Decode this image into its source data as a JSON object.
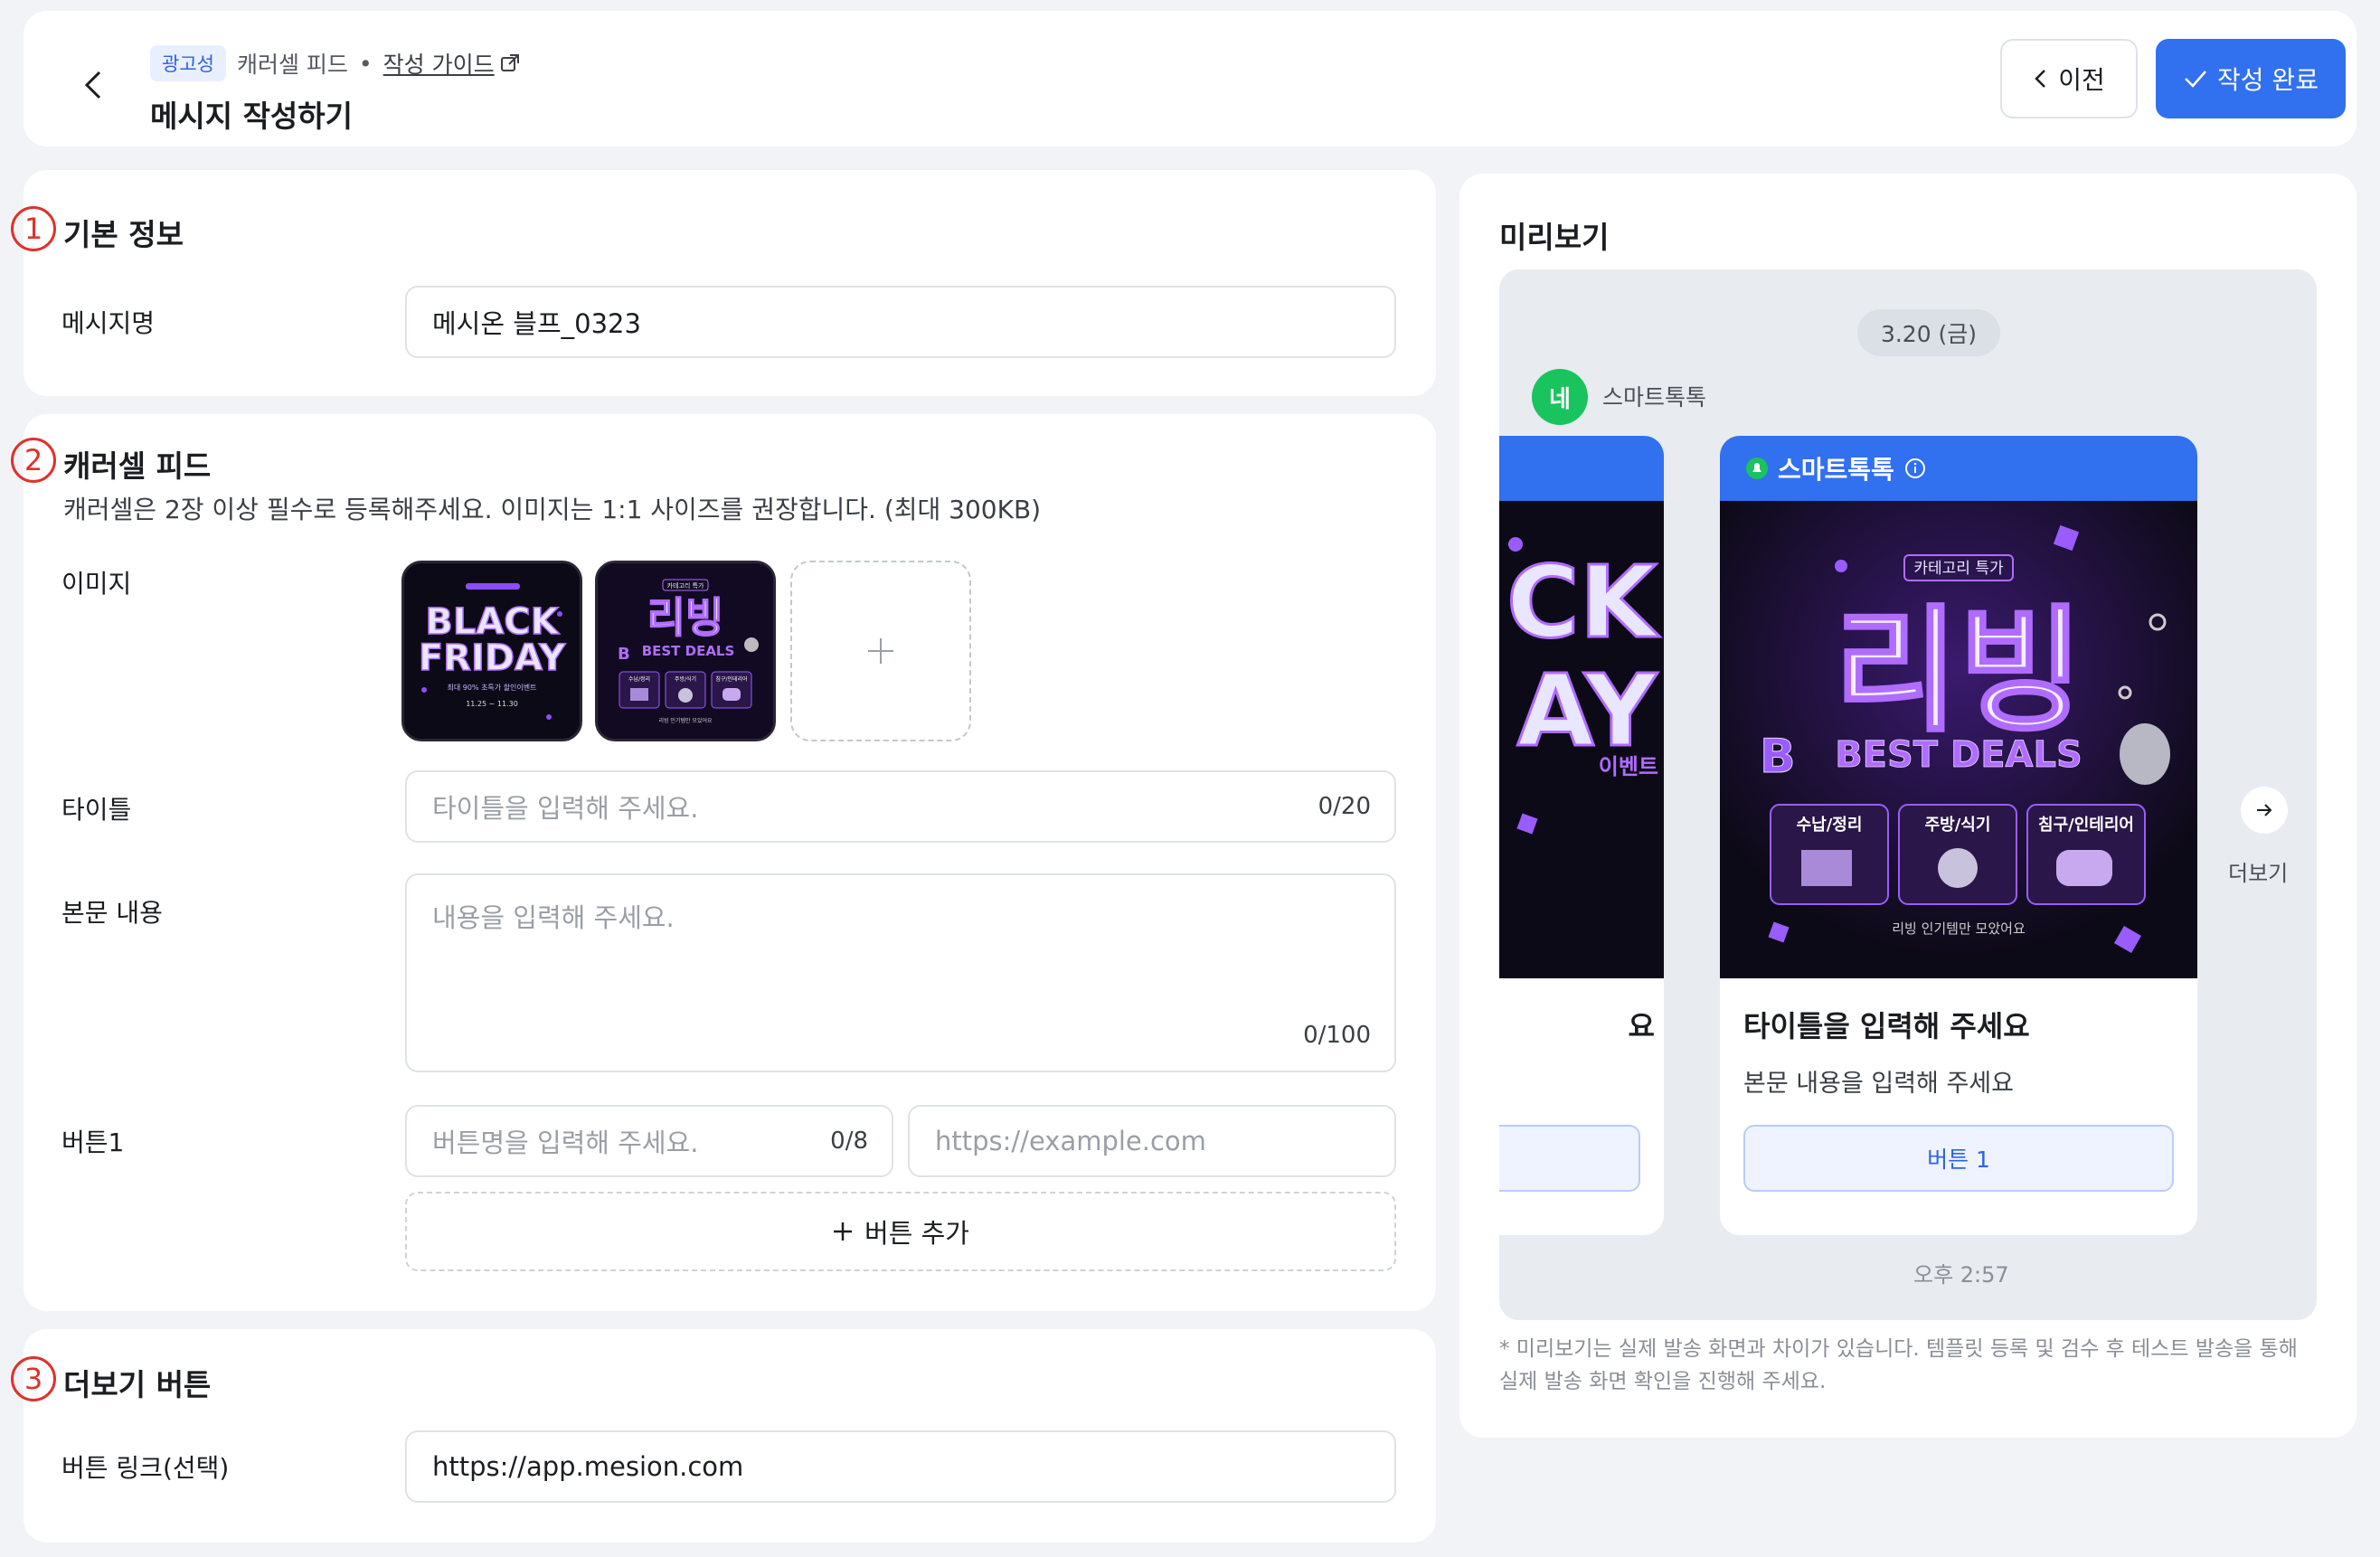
{
  "header": {
    "ad_badge": "광고성",
    "type": "캐러셀 피드",
    "dot": "•",
    "guide_link": "작성 가이드",
    "title": "메시지 작성하기",
    "prev_label": "이전",
    "done_label": "작성 완료"
  },
  "basic": {
    "num": "1",
    "title": "기본 정보",
    "name_label": "메시지명",
    "name_value": "메시온 블프_0323"
  },
  "carousel": {
    "num": "2",
    "title": "캐러셀 피드",
    "description": "캐러셀은 2장 이상 필수로 등록해주세요. 이미지는 1:1 사이즈를 권장합니다. (최대 300KB)",
    "image_label": "이미지",
    "thumbs": [
      {
        "line1": "BLACK",
        "line2": "FRIDAY",
        "caption": "최대 90% 초특가 할인이벤트",
        "dates": "11.25  ~  11.30"
      },
      {
        "top_tag": "카테고리 특가",
        "big": "리빙",
        "sub": "BEST DEALS",
        "cats": [
          "수납/정리",
          "주방/식기",
          "침구/인테리어"
        ],
        "caption": "리빙 인기템만 모았어요"
      }
    ],
    "title_label": "타이틀",
    "title_placeholder": "타이틀을 입력해 주세요.",
    "title_counter": "0/20",
    "body_label": "본문 내용",
    "body_placeholder": "내용을 입력해 주세요.",
    "body_counter": "0/100",
    "button_label": "버튼1",
    "button_name_placeholder": "버튼명을 입력해 주세요.",
    "button_name_counter": "0/8",
    "button_url_placeholder": "https://example.com",
    "add_button_label": "버튼 추가"
  },
  "more": {
    "num": "3",
    "title": "더보기 버튼",
    "link_label": "버튼 링크(선택)",
    "link_value": "https://app.mesion.com"
  },
  "preview": {
    "title": "미리보기",
    "date": "3.20 (금)",
    "avatar": "네",
    "sender": "스마트톡톡",
    "card_header": "스마트톡톡",
    "partial_text_1": "CK",
    "partial_text_2": "AY",
    "partial_event": "이벤트",
    "partial_title": "요",
    "card": {
      "tag": "카테고리 특가",
      "big": "리빙",
      "sub": "BEST DEALS",
      "cats": [
        "수납/정리",
        "주방/식기",
        "침구/인테리어"
      ],
      "caption": "리빙 인기템만 모았어요",
      "title": "타이틀을 입력해 주세요",
      "body": "본문 내용을 입력해 주세요",
      "button": "버튼 1"
    },
    "more_label": "더보기",
    "time": "오후 2:57",
    "note": "* 미리보기는 실제 발송 화면과 차이가 있습니다. 템플릿 등록 및 검수 후 테스트 발송을 통해 실제 발송 화면 확인을 진행해 주세요."
  },
  "colors": {
    "primary": "#3170ef",
    "annotation_red": "#e0312b",
    "neon_purple": "#b06cff",
    "sender_green": "#19c35e"
  }
}
